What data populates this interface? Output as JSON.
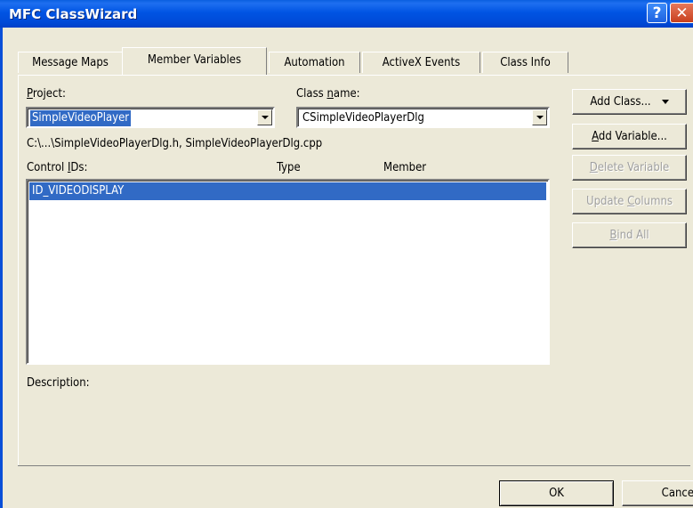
{
  "window": {
    "title": "MFC ClassWizard",
    "help_glyph": "?",
    "close_glyph": "✕"
  },
  "tabs": [
    {
      "label": "Message Maps",
      "active": false
    },
    {
      "label": "Member Variables",
      "active": true
    },
    {
      "label": "Automation",
      "active": false
    },
    {
      "label": "ActiveX Events",
      "active": false
    },
    {
      "label": "Class Info",
      "active": false
    }
  ],
  "form": {
    "project_label_pre": "",
    "project_label_u": "P",
    "project_label_post": "roject:",
    "project_value": "SimpleVideoPlayer",
    "classname_label_pre": "Class ",
    "classname_label_u": "n",
    "classname_label_post": "ame:",
    "classname_value": "CSimpleVideoPlayerDlg",
    "file_path": "C:\\...\\SimpleVideoPlayerDlg.h, SimpleVideoPlayerDlg.cpp",
    "control_ids_pre": "Control ",
    "control_ids_u": "I",
    "control_ids_post": "Ds:",
    "type_header": "Type",
    "member_header": "Member",
    "selected_row": "ID_VIDEODISPLAY",
    "description_label": "Description:"
  },
  "buttons": {
    "add_class": "Add Class...",
    "add_variable_u": "A",
    "add_variable_rest": "dd Variable...",
    "delete_variable_u": "D",
    "delete_variable_rest": "elete Variable",
    "update_columns_pre": "Update ",
    "update_columns_u": "C",
    "update_columns_post": "olumns",
    "bind_all_u": "B",
    "bind_all_rest": "ind All",
    "ok": "OK",
    "cancel": "Cancel"
  },
  "colors": {
    "titlebar": "#0054e3",
    "selection": "#316ac5",
    "dialog_bg": "#ece9d8"
  }
}
